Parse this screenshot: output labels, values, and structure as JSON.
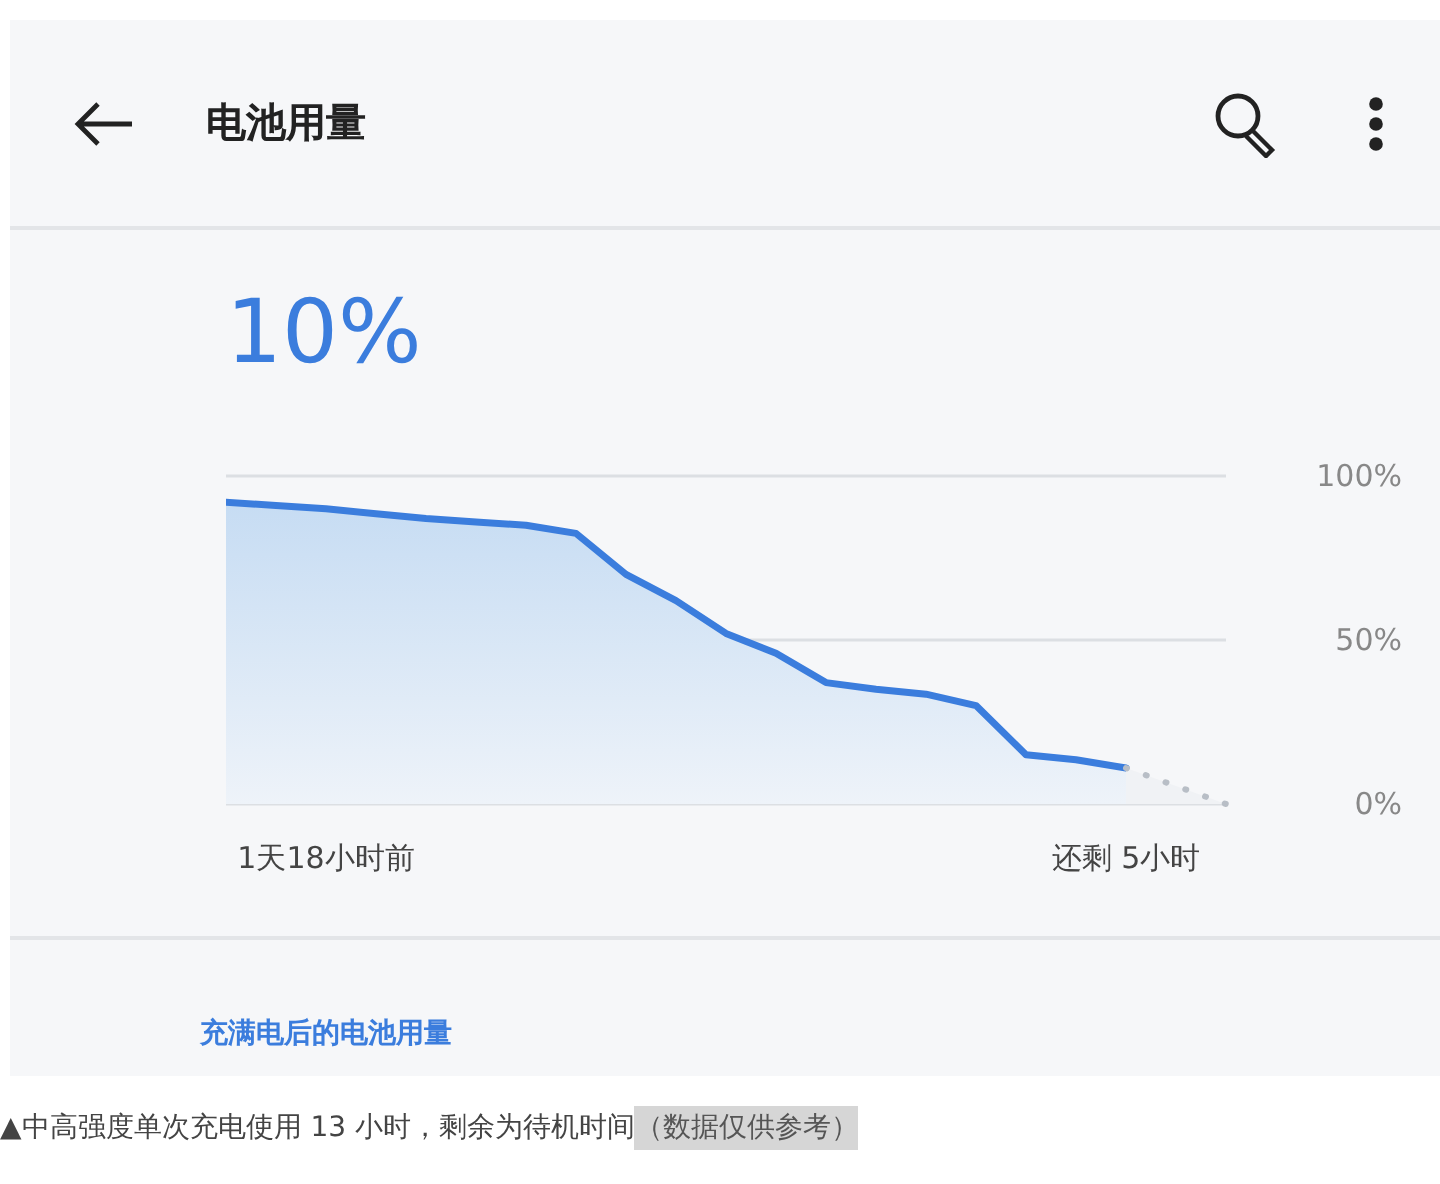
{
  "header": {
    "title": "电池用量"
  },
  "battery": {
    "percent": "10%"
  },
  "usage_chart": {
    "chart_data": {
      "type": "area",
      "categories": [
        null,
        null,
        "1天18小时前",
        null,
        null,
        null,
        null,
        null,
        null,
        null,
        null,
        null,
        null,
        null,
        null,
        null,
        null,
        null,
        "还剩 5小时",
        null,
        null
      ],
      "series": [
        {
          "color": "#3b7ddd",
          "values": [
            0.92,
            0.91,
            0.9,
            0.885,
            0.87,
            0.86,
            0.85,
            0.825,
            0.7,
            0.62,
            0.52,
            0.46,
            0.37,
            0.35,
            0.335,
            0.3,
            0.15,
            0.135,
            0.11,
            null,
            null
          ]
        },
        {
          "color": "#b8bec6",
          "values": [
            null,
            null,
            null,
            null,
            null,
            null,
            null,
            null,
            null,
            null,
            null,
            null,
            null,
            null,
            null,
            null,
            null,
            null,
            0.11,
            0.055,
            0.0
          ]
        }
      ],
      "ylim": [
        0,
        1
      ],
      "yticks": [
        {
          "value": 1,
          "label": "100%"
        },
        {
          "value": 0.5,
          "label": "50%"
        },
        {
          "value": 0,
          "label": "0%"
        }
      ]
    }
  },
  "section_link": "充满电后的电池用量",
  "caption": {
    "text": "▲中高强度单次充电使用 13 小时，剩余为待机时间",
    "note": "（数据仅供参考）"
  }
}
